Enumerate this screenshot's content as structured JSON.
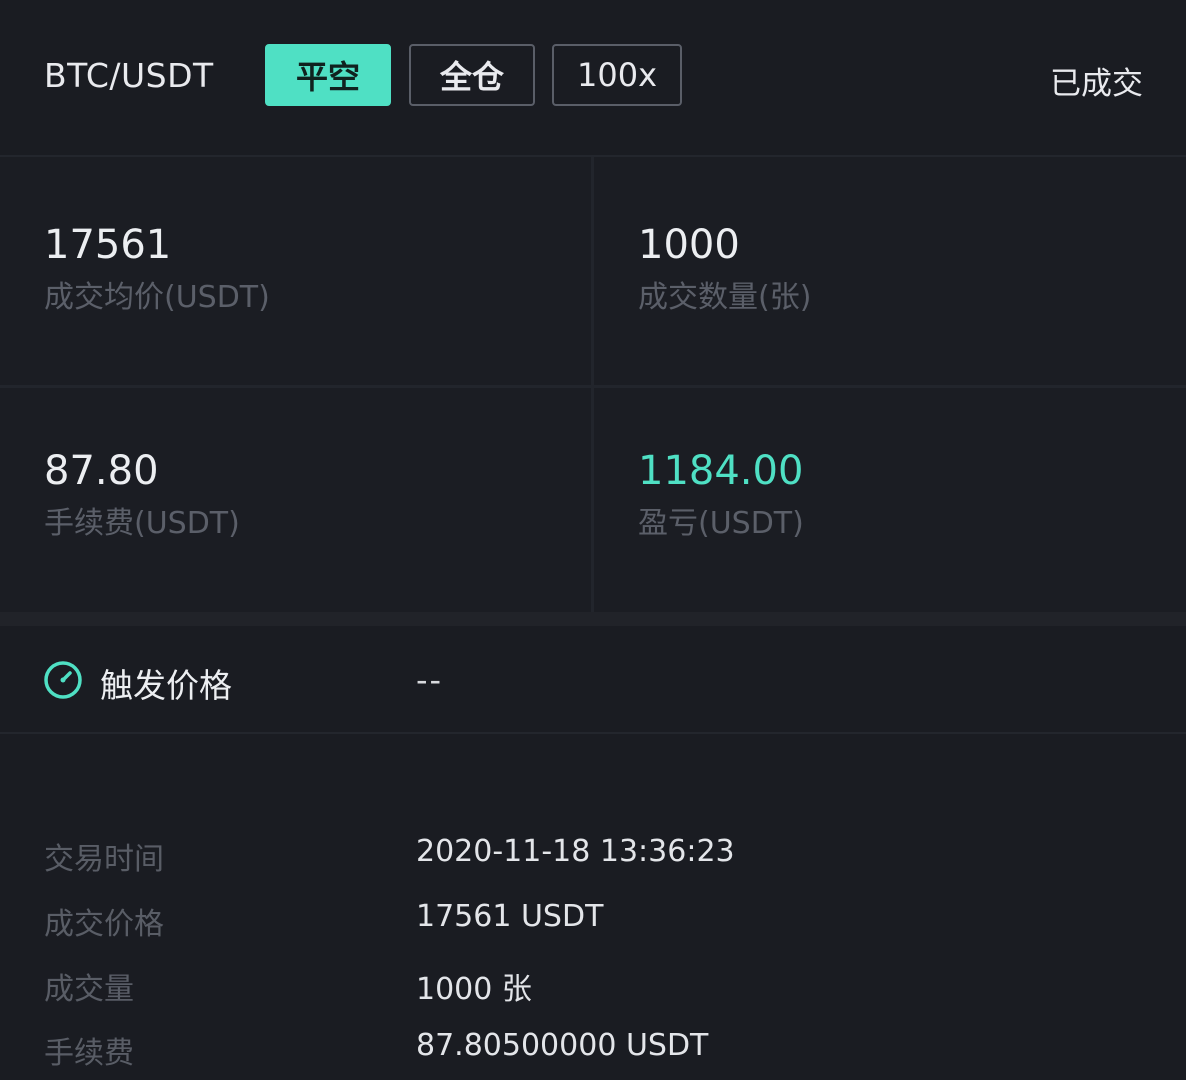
{
  "header": {
    "pair": "BTC/USDT",
    "tags": {
      "close_short": "平空",
      "cross_margin": "全仓",
      "leverage": "100x"
    },
    "status": "已成交"
  },
  "stats": {
    "avg_price": {
      "value": "17561",
      "label": "成交均价(USDT)"
    },
    "quantity": {
      "value": "1000",
      "label": "成交数量(张)"
    },
    "fee": {
      "value": "87.80",
      "label": "手续费(USDT)"
    },
    "pnl": {
      "value": "1184.00",
      "label": "盈亏(USDT)"
    }
  },
  "trigger": {
    "icon": "gauge-icon",
    "label": "触发价格",
    "value": "--"
  },
  "details": {
    "trade_time": {
      "label": "交易时间",
      "value": "2020-11-18 13:36:23"
    },
    "trade_price": {
      "label": "成交价格",
      "value": "17561 USDT"
    },
    "trade_volume": {
      "label": "成交量",
      "value": "1000 张"
    },
    "trade_fee": {
      "label": "手续费",
      "value": "87.80500000 USDT"
    }
  },
  "colors": {
    "accent": "#4fe0c4",
    "background": "#1a1c22",
    "muted_text": "#5b5f69"
  }
}
